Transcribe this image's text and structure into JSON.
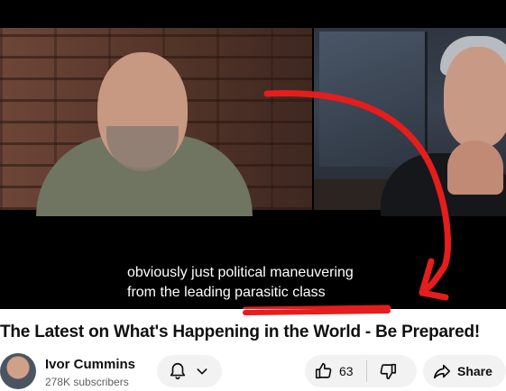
{
  "video": {
    "caption_lines": [
      "obviously just political maneuvering",
      "from the leading parasitic class"
    ],
    "annotation_color": "#e51d1d"
  },
  "title": "The Latest on What's Happening in the World - Be Prepared!",
  "channel": {
    "name": "Ivor Cummins",
    "subscribers": "278K subscribers"
  },
  "actions": {
    "bell_icon": "bell-icon",
    "like_count": "63",
    "share_label": "Share"
  }
}
